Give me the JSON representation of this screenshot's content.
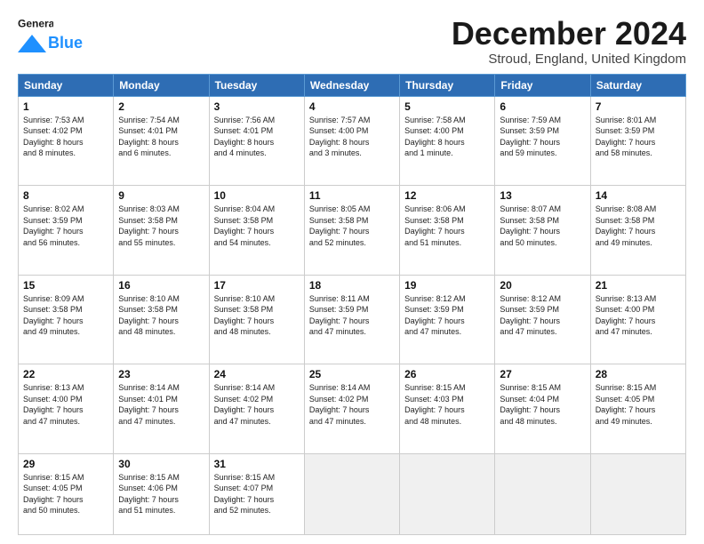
{
  "header": {
    "logo_line1": "General",
    "logo_line2": "Blue",
    "month": "December 2024",
    "location": "Stroud, England, United Kingdom"
  },
  "weekdays": [
    "Sunday",
    "Monday",
    "Tuesday",
    "Wednesday",
    "Thursday",
    "Friday",
    "Saturday"
  ],
  "weeks": [
    [
      {
        "day": "1",
        "info": "Sunrise: 7:53 AM\nSunset: 4:02 PM\nDaylight: 8 hours\nand 8 minutes."
      },
      {
        "day": "2",
        "info": "Sunrise: 7:54 AM\nSunset: 4:01 PM\nDaylight: 8 hours\nand 6 minutes."
      },
      {
        "day": "3",
        "info": "Sunrise: 7:56 AM\nSunset: 4:01 PM\nDaylight: 8 hours\nand 4 minutes."
      },
      {
        "day": "4",
        "info": "Sunrise: 7:57 AM\nSunset: 4:00 PM\nDaylight: 8 hours\nand 3 minutes."
      },
      {
        "day": "5",
        "info": "Sunrise: 7:58 AM\nSunset: 4:00 PM\nDaylight: 8 hours\nand 1 minute."
      },
      {
        "day": "6",
        "info": "Sunrise: 7:59 AM\nSunset: 3:59 PM\nDaylight: 7 hours\nand 59 minutes."
      },
      {
        "day": "7",
        "info": "Sunrise: 8:01 AM\nSunset: 3:59 PM\nDaylight: 7 hours\nand 58 minutes."
      }
    ],
    [
      {
        "day": "8",
        "info": "Sunrise: 8:02 AM\nSunset: 3:59 PM\nDaylight: 7 hours\nand 56 minutes."
      },
      {
        "day": "9",
        "info": "Sunrise: 8:03 AM\nSunset: 3:58 PM\nDaylight: 7 hours\nand 55 minutes."
      },
      {
        "day": "10",
        "info": "Sunrise: 8:04 AM\nSunset: 3:58 PM\nDaylight: 7 hours\nand 54 minutes."
      },
      {
        "day": "11",
        "info": "Sunrise: 8:05 AM\nSunset: 3:58 PM\nDaylight: 7 hours\nand 52 minutes."
      },
      {
        "day": "12",
        "info": "Sunrise: 8:06 AM\nSunset: 3:58 PM\nDaylight: 7 hours\nand 51 minutes."
      },
      {
        "day": "13",
        "info": "Sunrise: 8:07 AM\nSunset: 3:58 PM\nDaylight: 7 hours\nand 50 minutes."
      },
      {
        "day": "14",
        "info": "Sunrise: 8:08 AM\nSunset: 3:58 PM\nDaylight: 7 hours\nand 49 minutes."
      }
    ],
    [
      {
        "day": "15",
        "info": "Sunrise: 8:09 AM\nSunset: 3:58 PM\nDaylight: 7 hours\nand 49 minutes."
      },
      {
        "day": "16",
        "info": "Sunrise: 8:10 AM\nSunset: 3:58 PM\nDaylight: 7 hours\nand 48 minutes."
      },
      {
        "day": "17",
        "info": "Sunrise: 8:10 AM\nSunset: 3:58 PM\nDaylight: 7 hours\nand 48 minutes."
      },
      {
        "day": "18",
        "info": "Sunrise: 8:11 AM\nSunset: 3:59 PM\nDaylight: 7 hours\nand 47 minutes."
      },
      {
        "day": "19",
        "info": "Sunrise: 8:12 AM\nSunset: 3:59 PM\nDaylight: 7 hours\nand 47 minutes."
      },
      {
        "day": "20",
        "info": "Sunrise: 8:12 AM\nSunset: 3:59 PM\nDaylight: 7 hours\nand 47 minutes."
      },
      {
        "day": "21",
        "info": "Sunrise: 8:13 AM\nSunset: 4:00 PM\nDaylight: 7 hours\nand 47 minutes."
      }
    ],
    [
      {
        "day": "22",
        "info": "Sunrise: 8:13 AM\nSunset: 4:00 PM\nDaylight: 7 hours\nand 47 minutes."
      },
      {
        "day": "23",
        "info": "Sunrise: 8:14 AM\nSunset: 4:01 PM\nDaylight: 7 hours\nand 47 minutes."
      },
      {
        "day": "24",
        "info": "Sunrise: 8:14 AM\nSunset: 4:02 PM\nDaylight: 7 hours\nand 47 minutes."
      },
      {
        "day": "25",
        "info": "Sunrise: 8:14 AM\nSunset: 4:02 PM\nDaylight: 7 hours\nand 47 minutes."
      },
      {
        "day": "26",
        "info": "Sunrise: 8:15 AM\nSunset: 4:03 PM\nDaylight: 7 hours\nand 48 minutes."
      },
      {
        "day": "27",
        "info": "Sunrise: 8:15 AM\nSunset: 4:04 PM\nDaylight: 7 hours\nand 48 minutes."
      },
      {
        "day": "28",
        "info": "Sunrise: 8:15 AM\nSunset: 4:05 PM\nDaylight: 7 hours\nand 49 minutes."
      }
    ],
    [
      {
        "day": "29",
        "info": "Sunrise: 8:15 AM\nSunset: 4:05 PM\nDaylight: 7 hours\nand 50 minutes."
      },
      {
        "day": "30",
        "info": "Sunrise: 8:15 AM\nSunset: 4:06 PM\nDaylight: 7 hours\nand 51 minutes."
      },
      {
        "day": "31",
        "info": "Sunrise: 8:15 AM\nSunset: 4:07 PM\nDaylight: 7 hours\nand 52 minutes."
      },
      null,
      null,
      null,
      null
    ]
  ]
}
